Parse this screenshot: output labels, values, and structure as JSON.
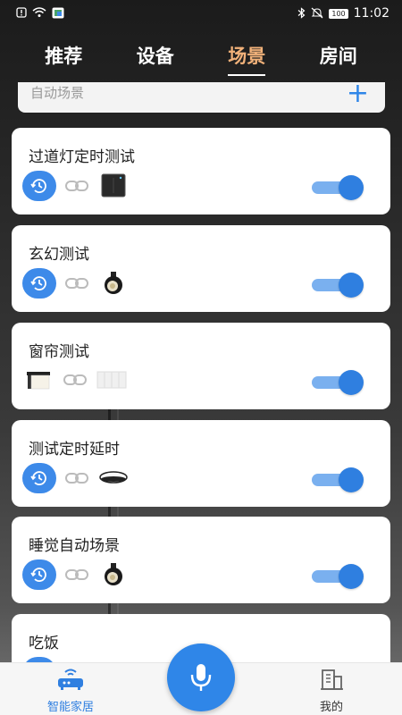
{
  "status_bar": {
    "time": "11:02",
    "battery": "100",
    "left_icons": [
      "alert-icon",
      "wifi-icon",
      "app-icon"
    ],
    "right_icons": [
      "bluetooth-icon",
      "mute-icon",
      "battery-icon"
    ]
  },
  "tabs": [
    {
      "label": "推荐",
      "active": false
    },
    {
      "label": "设备",
      "active": false
    },
    {
      "label": "场景",
      "active": true
    },
    {
      "label": "房间",
      "active": false
    }
  ],
  "auto_scene": {
    "label": "自动场景",
    "add_icon": "plus-icon"
  },
  "scenes": [
    {
      "name": "过道灯定时测试",
      "timer": true,
      "device": "wall-switch",
      "enabled": true
    },
    {
      "name": "玄幻测试",
      "timer": true,
      "device": "spotlight",
      "enabled": true
    },
    {
      "name": "窗帘测试",
      "timer": false,
      "device": "curtain",
      "enabled": true
    },
    {
      "name": "测试定时延时",
      "timer": true,
      "device": "ceiling-light",
      "enabled": true
    },
    {
      "name": "睡觉自动场景",
      "timer": true,
      "device": "spotlight",
      "enabled": true
    },
    {
      "name": "吃饭",
      "timer": true,
      "device": "",
      "enabled": true
    }
  ],
  "bottom_nav": {
    "home_label": "智能家居",
    "mine_label": "我的",
    "mic_icon": "microphone-icon"
  },
  "colors": {
    "accent": "#2f86e8",
    "active_tab": "#f2b27a",
    "toggle_track": "#7ab0ef"
  }
}
